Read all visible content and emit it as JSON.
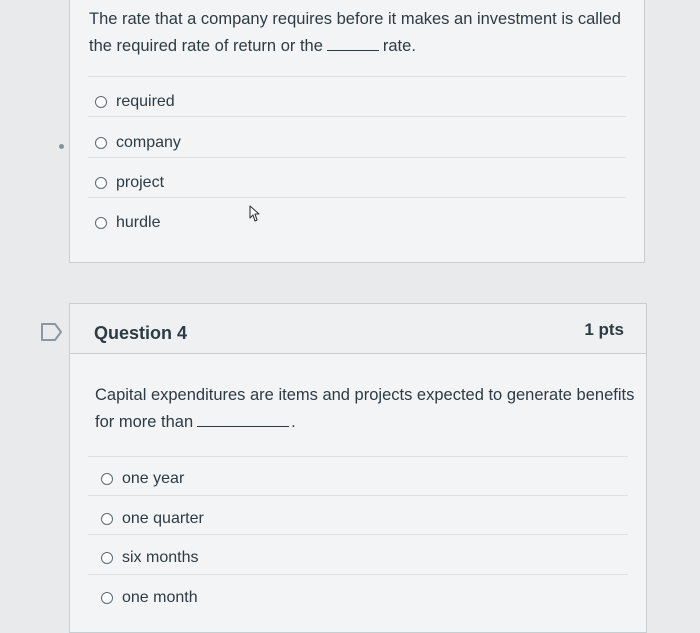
{
  "question3": {
    "text_before": "The rate that a company requires before it makes an investment is called the required rate of return or the",
    "text_after": "rate.",
    "options": [
      "required",
      "company",
      "project",
      "hurdle"
    ]
  },
  "question4": {
    "title": "Question 4",
    "points": "1 pts",
    "text_before": "Capital expenditures are items and projects expected to generate benefits for more than",
    "text_after": ".",
    "options": [
      "one year",
      "one quarter",
      "six months",
      "one month"
    ]
  }
}
